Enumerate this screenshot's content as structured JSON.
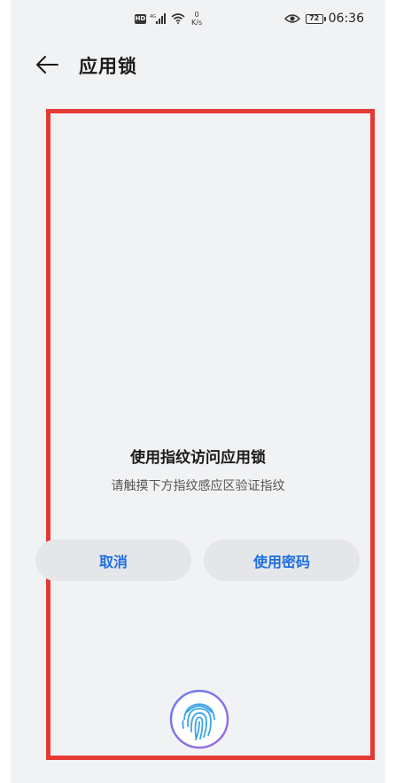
{
  "status_bar": {
    "hd": "HD",
    "network": "4G",
    "speed_value": "0",
    "speed_unit": "K/s",
    "battery": "72",
    "time": "06:36"
  },
  "header": {
    "title": "应用锁"
  },
  "dialog": {
    "title": "使用指纹访问应用锁",
    "subtitle": "请触摸下方指纹感应区验证指纹",
    "cancel_label": "取消",
    "password_label": "使用密码"
  },
  "colors": {
    "accent": "#1f6fe0",
    "highlight": "#e53935",
    "background": "#f1f2f4"
  }
}
